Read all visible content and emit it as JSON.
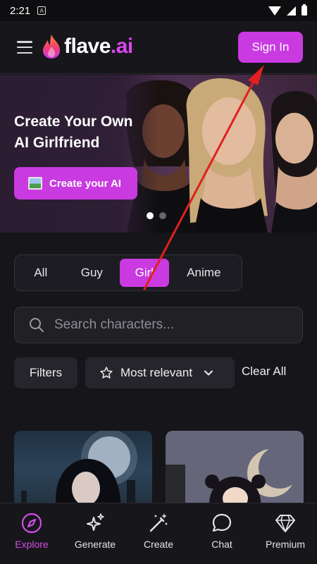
{
  "status_bar": {
    "time": "2:21"
  },
  "header": {
    "logo_main": "flave",
    "logo_dot_ai": ".ai",
    "sign_in_label": "Sign In"
  },
  "banner": {
    "title_line1": "Create Your Own",
    "title_line2": "AI Girlfriend",
    "cta_label": "Create your AI",
    "slides_total": 2,
    "slide_active": 1
  },
  "category_tabs": [
    {
      "label": "All",
      "active": false
    },
    {
      "label": "Guy",
      "active": false
    },
    {
      "label": "Girl",
      "active": true
    },
    {
      "label": "Anime",
      "active": false
    }
  ],
  "search": {
    "placeholder": "Search characters..."
  },
  "filters": {
    "filters_label": "Filters",
    "sort_label": "Most relevant",
    "clear_label": "Clear All"
  },
  "bottom_nav": [
    {
      "label": "Explore",
      "icon": "compass-icon",
      "active": true
    },
    {
      "label": "Generate",
      "icon": "sparkles-icon",
      "active": false
    },
    {
      "label": "Create",
      "icon": "magic-wand-icon",
      "active": false
    },
    {
      "label": "Chat",
      "icon": "chat-bubble-icon",
      "active": false
    },
    {
      "label": "Premium",
      "icon": "diamond-icon",
      "active": false
    }
  ],
  "colors": {
    "accent": "#c93ae0",
    "background": "#161519",
    "annotation_arrow": "#e0201e"
  }
}
